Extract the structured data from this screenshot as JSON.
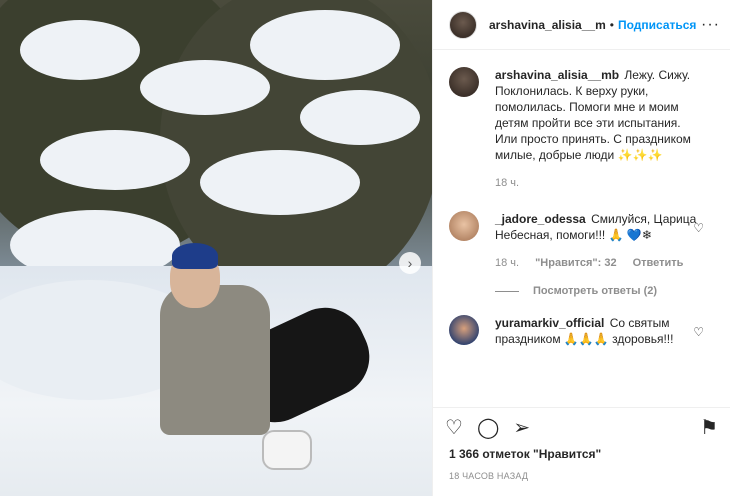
{
  "post": {
    "next_icon": "chevron-right-icon",
    "next_glyph": "›"
  },
  "header": {
    "username": "arshavina_alisia__m",
    "separator": "•",
    "follow_label": "Подписаться",
    "more_glyph": "···"
  },
  "caption": {
    "username": "arshavina_alisia__mb",
    "text": "Лежу. Сижу. Поклонилась. К верху руки, помолилась. Помоги мне и моим детям пройти все эти испытания. Или просто принять. С праздником милые, добрые люди ✨✨✨",
    "age": "18 ч."
  },
  "comments": [
    {
      "username": "_jadore_odessa",
      "text": "Смилуйся, Царица Небесная, помоги!!! 🙏 💙❄",
      "age": "18 ч.",
      "likes": "\"Нравится\": 32",
      "reply_label": "Ответить",
      "view_replies": "Посмотреть ответы (2)"
    },
    {
      "username": "yuramarkiv_official",
      "text": "Со святым праздником 🙏🙏🙏 здоровья!!!"
    }
  ],
  "actions": {
    "like_glyph": "♡",
    "comment_glyph": "◯",
    "share_glyph": "➢",
    "save_glyph": "⚑"
  },
  "footer": {
    "likes": "1 366 отметок \"Нравится\"",
    "time": "18 ЧАСОВ НАЗАД"
  }
}
